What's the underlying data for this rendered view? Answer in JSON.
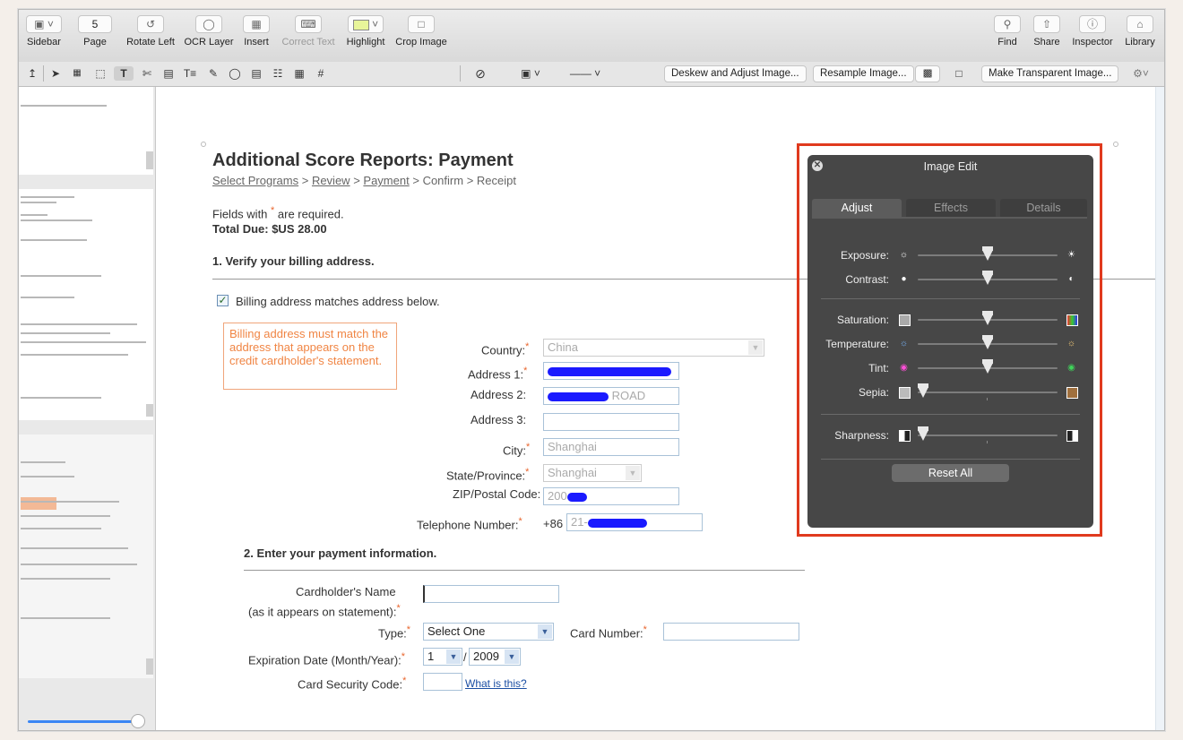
{
  "toolbar": {
    "sidebar": "Sidebar",
    "page": "Page",
    "page_value": "5",
    "rotate_left": "Rotate Left",
    "ocr_layer": "OCR Layer",
    "insert": "Insert",
    "correct_text": "Correct Text",
    "highlight": "Highlight",
    "crop_image": "Crop Image",
    "find": "Find",
    "share": "Share",
    "inspector": "Inspector",
    "library": "Library"
  },
  "secondbar": {
    "deskew": "Deskew and Adjust Image...",
    "resample": "Resample Image...",
    "make_transparent": "Make Transparent Image..."
  },
  "doc": {
    "title": "Additional Score Reports: Payment",
    "crumb_1": "Select Programs",
    "crumb_2": "Review",
    "crumb_3": "Payment",
    "crumb_4": "Confirm",
    "crumb_5": "Receipt",
    "crumb_sep": ">",
    "fields_note_a": "Fields with",
    "fields_note_b": "are required.",
    "asterisk": "*",
    "total_due": "Total Due: $US 28.00",
    "section_1": "1. Verify your billing address.",
    "billing_match": "Billing address matches address below.",
    "warning": "Billing address must match the address that appears on the credit cardholder's statement.",
    "country_label": "Country:",
    "country_value": "China",
    "address1_label": "Address 1:",
    "address2_label": "Address 2:",
    "address2_value": "ROAD",
    "address3_label": "Address 3:",
    "city_label": "City:",
    "city_value": "Shanghai",
    "state_label": "State/Province:",
    "state_value": "Shanghai",
    "zip_label": "ZIP/Postal Code:",
    "zip_value": "200",
    "phone_label": "Telephone Number:",
    "phone_prefix": "+86",
    "phone_value": "21-",
    "section_2": "2. Enter your payment information.",
    "cardholder_label_1": "Cardholder's Name",
    "cardholder_label_2": "(as it appears on statement):",
    "type_label": "Type:",
    "type_value": "Select One",
    "card_number_label": "Card Number:",
    "expiration_label": "Expiration Date (Month/Year):",
    "exp_month": "1",
    "exp_slash": "/",
    "exp_year": "2009",
    "security_label": "Card Security Code:",
    "what_is_this": "What is this?"
  },
  "panel": {
    "title": "Image Edit",
    "tabs": [
      "Adjust",
      "Effects",
      "Details"
    ],
    "sliders": [
      {
        "label": "Exposure:",
        "value": 0.5
      },
      {
        "label": "Contrast:",
        "value": 0.5
      },
      {
        "label": "Saturation:",
        "value": 0.5
      },
      {
        "label": "Temperature:",
        "value": 0.5
      },
      {
        "label": "Tint:",
        "value": 0.5
      },
      {
        "label": "Sepia:",
        "value": 0.0
      },
      {
        "label": "Sharpness:",
        "value": 0.0
      }
    ],
    "reset_all": "Reset All"
  },
  "colors": {
    "highlight_frame": "#e03a1e",
    "panel_bg": "#474747",
    "required": "#e8642c",
    "link": "#1a4ea3"
  }
}
